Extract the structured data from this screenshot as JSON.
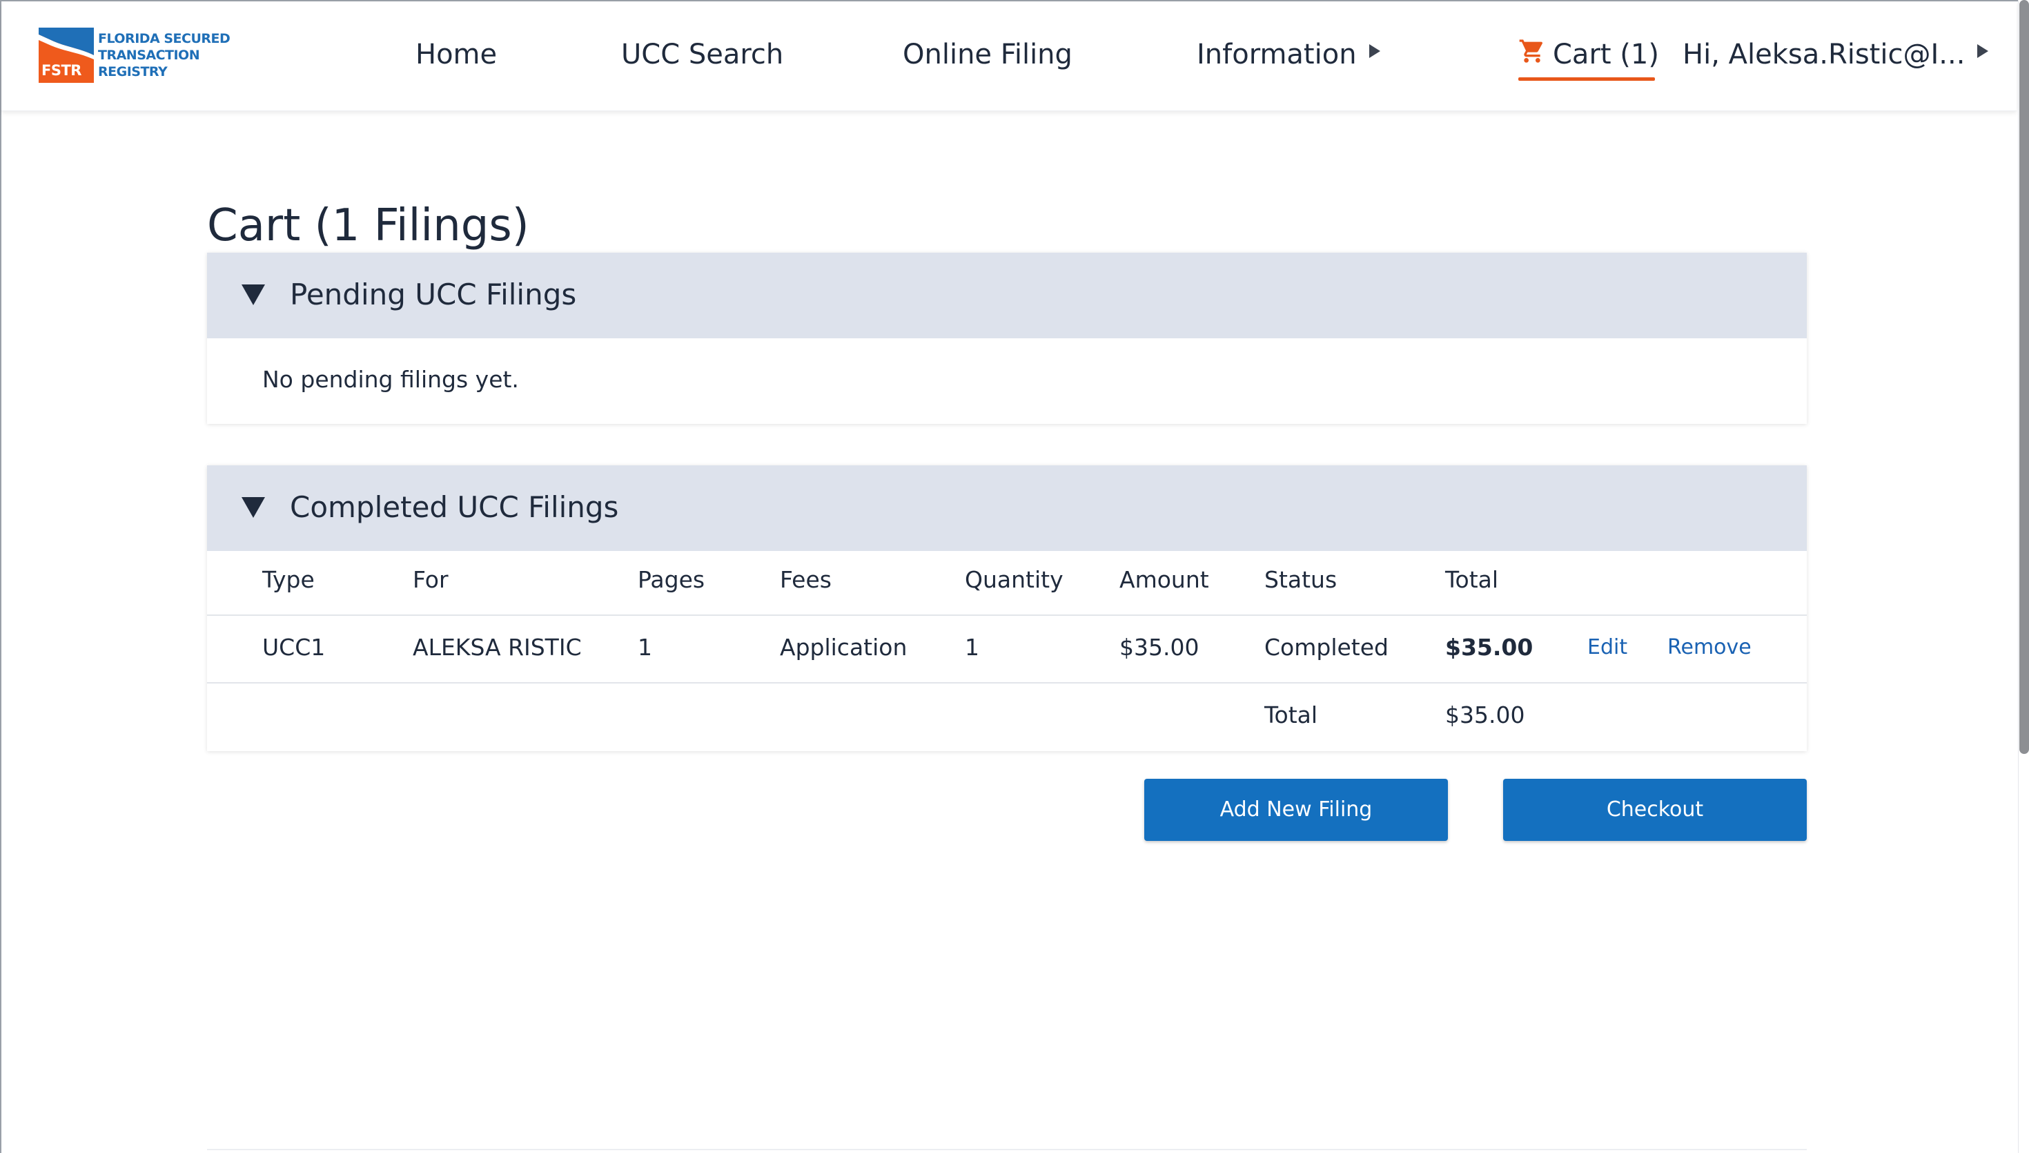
{
  "logo": {
    "line1": "FLORIDA SECURED",
    "line2": "TRANSACTION",
    "line3": "REGISTRY",
    "acronym": "FSTR"
  },
  "nav": {
    "home": "Home",
    "ucc_search": "UCC Search",
    "online_filing": "Online Filing",
    "information": "Information",
    "cart": "Cart (1)",
    "user": "Hi, Aleksa.Ristic@I..."
  },
  "page": {
    "title": "Cart (1 Filings)"
  },
  "pending": {
    "title": "Pending UCC Filings",
    "empty_message": "No pending filings yet."
  },
  "completed": {
    "title": "Completed UCC Filings",
    "columns": [
      "Type",
      "For",
      "Pages",
      "Fees",
      "Quantity",
      "Amount",
      "Status",
      "Total"
    ],
    "rows": [
      {
        "type": "UCC1",
        "for": "ALEKSA RISTIC",
        "pages": "1",
        "fees": "Application",
        "quantity": "1",
        "amount": "$35.00",
        "status": "Completed",
        "total": "$35.00",
        "edit_label": "Edit",
        "remove_label": "Remove"
      }
    ],
    "total_label": "Total",
    "total_value": "$35.00"
  },
  "actions": {
    "add_new_filing": "Add New Filing",
    "checkout": "Checkout"
  },
  "colors": {
    "brand_blue": "#1470bf",
    "accent_orange": "#e8571a",
    "header_bg": "#dde2ec",
    "link_blue": "#1a62b3"
  }
}
